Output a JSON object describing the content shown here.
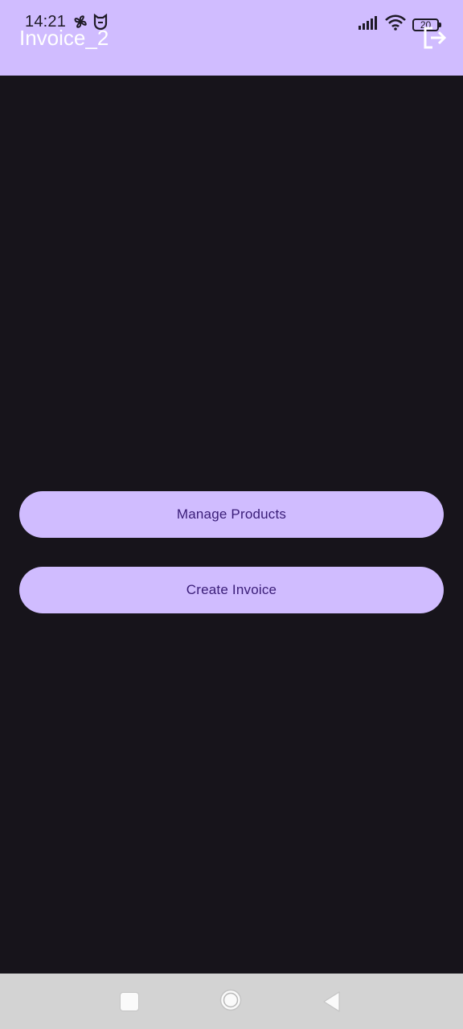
{
  "status_bar": {
    "time": "14:21",
    "battery_level": "20",
    "icons": [
      "fan-icon",
      "mi-icon",
      "signal-icon",
      "wifi-icon",
      "battery-icon"
    ]
  },
  "app_bar": {
    "title": "Invoice_2",
    "action_icon": "logout-icon"
  },
  "main": {
    "buttons": [
      {
        "label": "Manage Products"
      },
      {
        "label": "Create Invoice"
      }
    ]
  },
  "nav_bar": {
    "icons": [
      "recent-apps-icon",
      "home-icon",
      "back-icon"
    ]
  },
  "colors": {
    "app_bar_bg": "#d0bcff",
    "body_bg": "#17141b",
    "button_bg": "#d0bcff",
    "button_text": "#3a1d78",
    "nav_bar_bg": "#d3d3d3"
  }
}
